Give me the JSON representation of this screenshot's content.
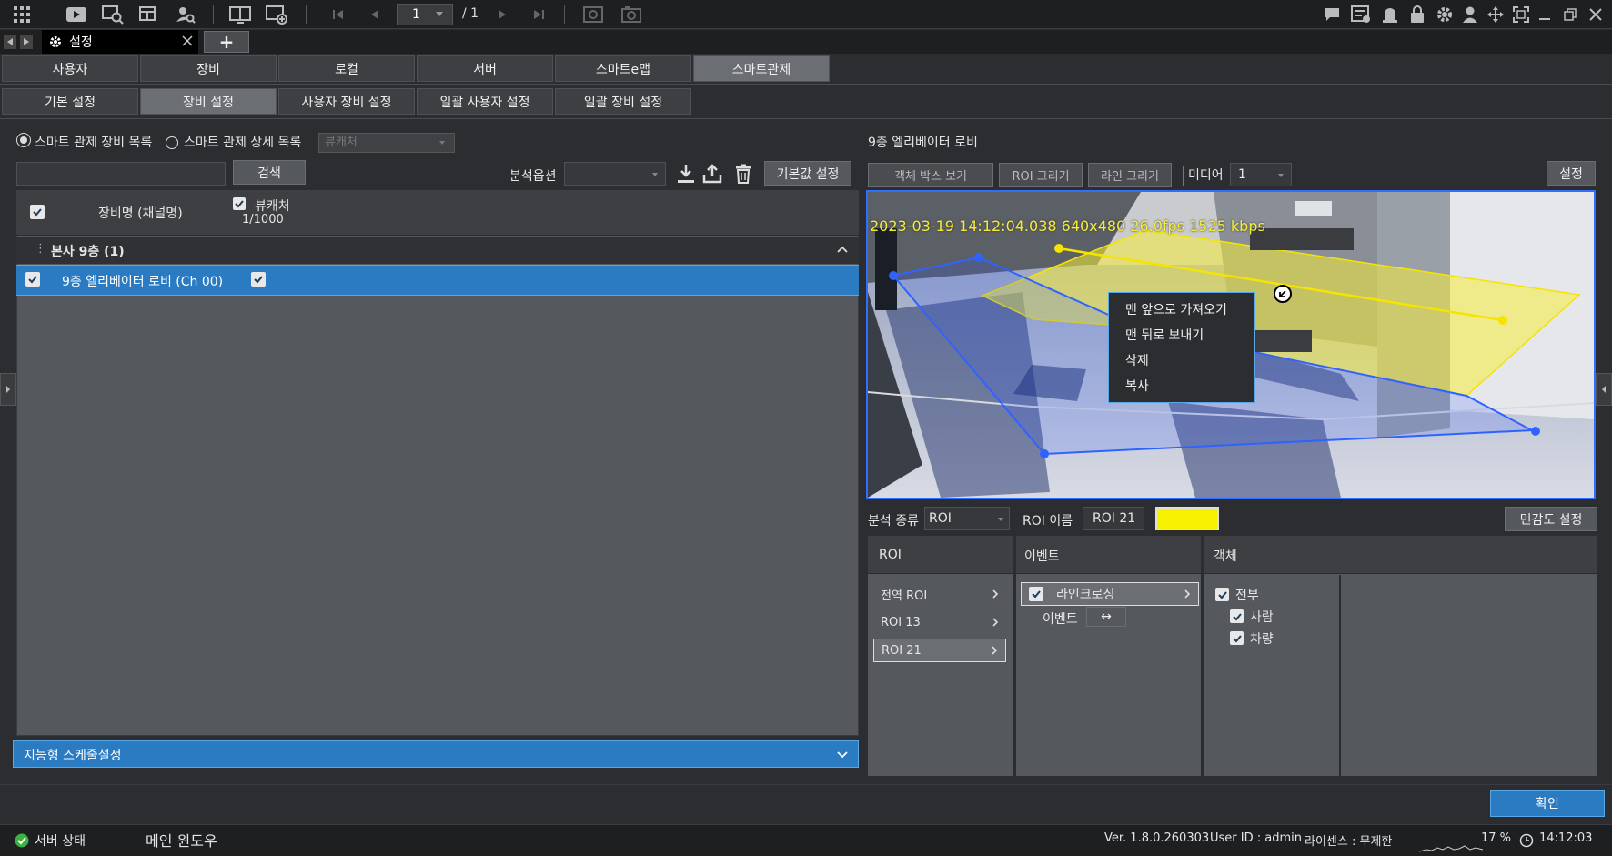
{
  "toolbar": {
    "page_current": "1",
    "page_total": "/ 1"
  },
  "window_tab": {
    "label": "설정",
    "add_label": "+"
  },
  "main_tabs": [
    {
      "label": "사용자"
    },
    {
      "label": "장비"
    },
    {
      "label": "로컬"
    },
    {
      "label": "서버"
    },
    {
      "label": "스마트e맵"
    },
    {
      "label": "스마트관제"
    }
  ],
  "sub_tabs": [
    {
      "label": "기본 설정"
    },
    {
      "label": "장비 설정"
    },
    {
      "label": "사용자 장비 설정"
    },
    {
      "label": "일괄 사용자 설정"
    },
    {
      "label": "일괄 장비 설정"
    }
  ],
  "left": {
    "radio1": "스마트 관제 장비 목록",
    "radio2": "스마트 관제 상세 목록",
    "viewer_select": "뷰캐처",
    "search_button": "검색",
    "analysis_option_label": "분석옵션",
    "default_button": "기본값 설정",
    "col_device": "장비명 (채널명)",
    "col_viewer": "뷰캐처",
    "col_count": "1/1000",
    "group_label": "본사 9층 (1)",
    "device_row": "9층 엘리베이터 로비 (Ch 00)",
    "schedule_label": "지능형 스케줄설정"
  },
  "right": {
    "title": "9층 엘리베이터 로비",
    "btn_object_box": "객체 박스 보기",
    "btn_roi_draw": "ROI 그리기",
    "btn_line_draw": "라인 그리기",
    "media_label": "미디어",
    "media_value": "1",
    "settings_button": "설정",
    "overlay_text": "2023-03-19 14:12:04.038 640x480  26.0fps 1525 kbps",
    "context_menu": [
      "맨 앞으로 가져오기",
      "맨 뒤로 보내기",
      "삭제",
      "복사"
    ],
    "analysis_type_label": "분석 종류",
    "analysis_type_value": "ROI",
    "roi_name_label": "ROI 이름",
    "roi_name_value": "ROI 21",
    "roi_color": "#f7f000",
    "sensitivity_button": "민감도 설정",
    "roi_header": "ROI",
    "event_header": "이벤트",
    "object_header": "객체",
    "roi_items": [
      "전역 ROI",
      "ROI 13",
      "ROI 21"
    ],
    "event_item": "라인크로싱",
    "event_sub_label": "이벤트",
    "event_sub_value": "↔",
    "objects": [
      "전부",
      "사람",
      "차량"
    ]
  },
  "confirm_button": "확인",
  "status": {
    "server_status": "서버 상태",
    "main_window": "메인 윈도우",
    "version": "Ver. 1.8.0.260303",
    "user_id": "User ID : admin",
    "license": "라이센스 : 무제한",
    "cpu": "17 %",
    "time": "14:12:03"
  }
}
